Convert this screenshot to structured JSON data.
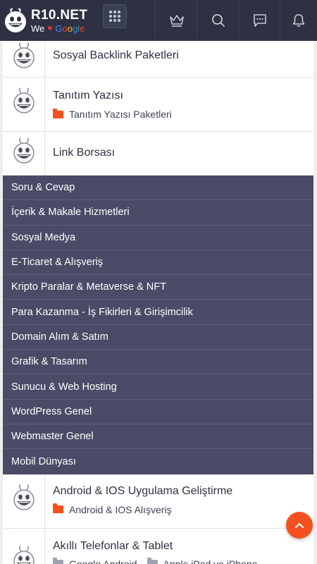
{
  "header": {
    "logo_title": "R10.NET",
    "logo_we": "We",
    "logo_google": [
      "G",
      "o",
      "o",
      "g",
      "l",
      "e"
    ],
    "icons": [
      "apps-grid-icon",
      "crown-icon",
      "search-icon",
      "messages-icon",
      "bell-icon"
    ]
  },
  "forums_top": [
    {
      "title": "Sosyal Backlink Paketleri",
      "subs": []
    },
    {
      "title": "Tanıtım Yazısı",
      "subs": [
        "Tanıtım Yazısı Paketleri"
      ]
    },
    {
      "title": "Link Borsası",
      "subs": []
    }
  ],
  "categories": [
    "Soru & Cevap",
    "İçerik & Makale Hizmetleri",
    "Sosyal Medya",
    "E-Ticaret & Alışveriş",
    "Kripto Paralar & Metaverse & NFT",
    "Para Kazanma - İş Fikirleri & Girişimcilik",
    "Domain Alım & Satım",
    "Grafik & Tasarım",
    "Sunucu & Web Hosting",
    "WordPress Genel",
    "Webmaster Genel",
    "Mobil Dünyası"
  ],
  "forums_bottom": [
    {
      "title": "Android & IOS Uygulama Geliştirme",
      "subs": [
        "Android & IOS Alışveriş"
      ]
    },
    {
      "title": "Akıllı Telefonlar & Tablet",
      "subs": [
        "Google Android",
        "Apple iPad ve iPhone"
      ]
    }
  ],
  "colors": {
    "header_bg": "#2d3142",
    "category_bg": "#4a4b67",
    "accent": "#f4511e",
    "heart": "#e53935"
  },
  "scroll_top_icon": "chevron-up-icon"
}
